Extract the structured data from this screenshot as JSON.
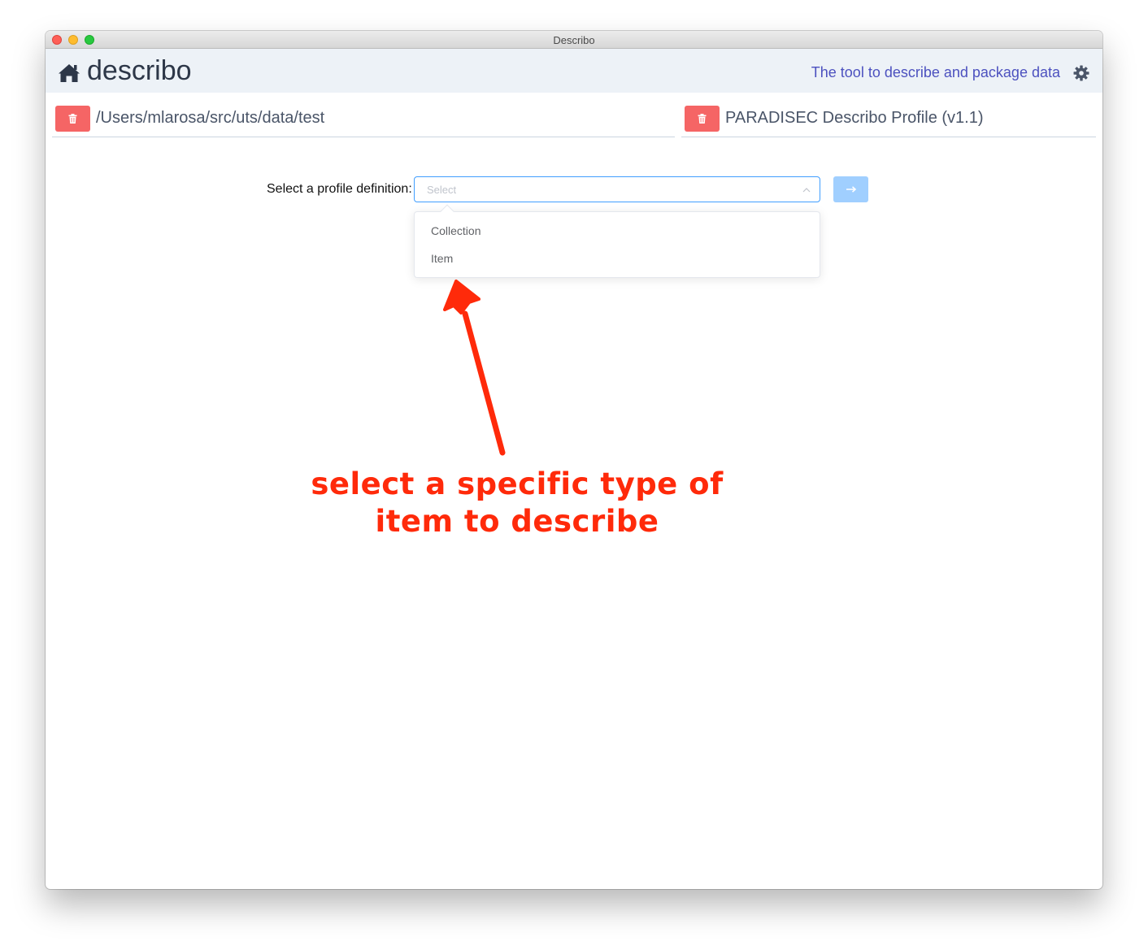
{
  "window": {
    "title": "Describo"
  },
  "header": {
    "app_name": "describo",
    "tagline": "The tool to describe and package data"
  },
  "paths": {
    "folder": "/Users/mlarosa/src/uts/data/test",
    "profile": "PARADISEC Describo Profile (v1.1)"
  },
  "profile_select": {
    "label": "Select a profile definition:",
    "placeholder": "Select",
    "options": [
      "Collection",
      "Item"
    ]
  },
  "annotation": {
    "line1": "select a specific type of",
    "line2": "item to describe",
    "color": "#ff2a0a"
  },
  "colors": {
    "delete_button": "#f56565",
    "header_bg": "#edf2f7",
    "tagline": "#4c51bf",
    "go_button": "#a0cfff",
    "select_border": "#409eff"
  }
}
